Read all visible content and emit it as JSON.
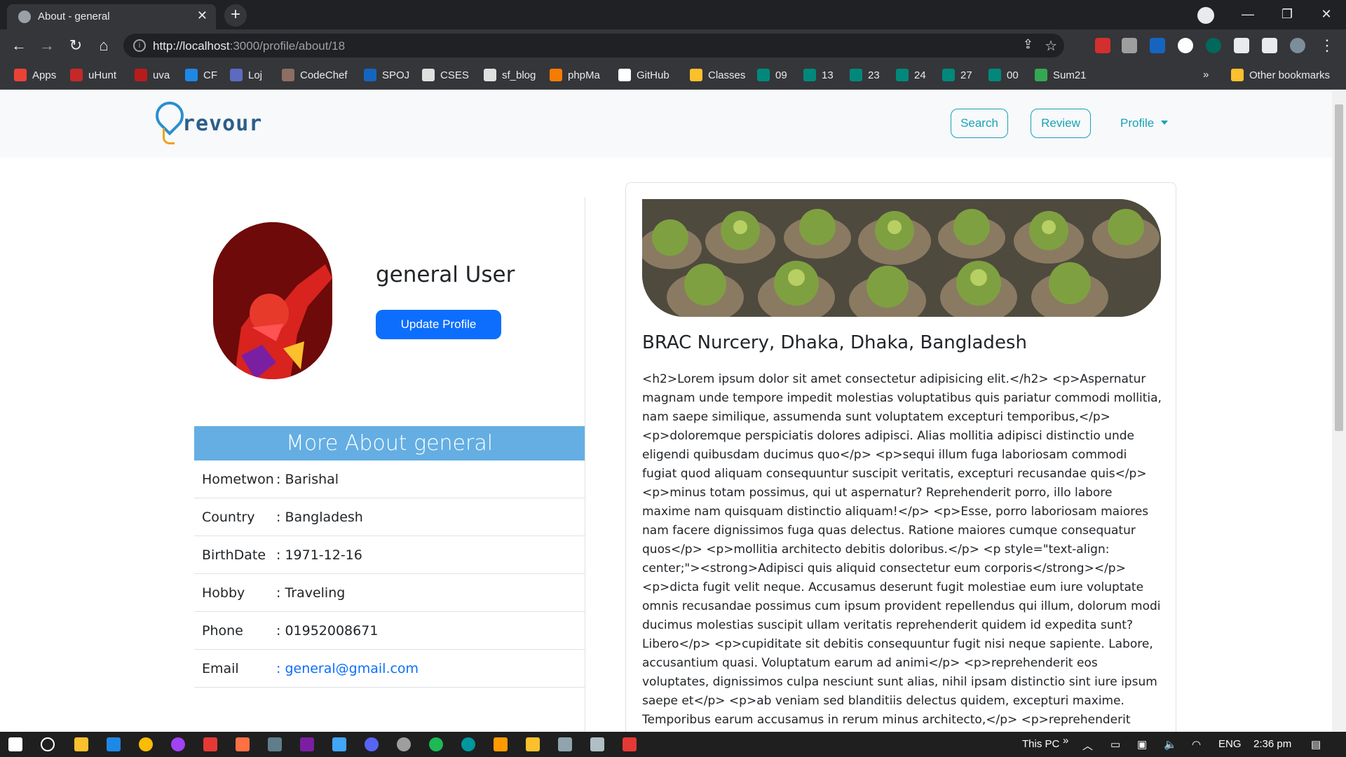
{
  "browser": {
    "tab_title": "About - general",
    "tab_close": "✕",
    "new_tab": "+",
    "url_host": "http://localhost",
    "url_path": ":3000/profile/about/18",
    "window_controls": [
      "—",
      "❐",
      "✕"
    ]
  },
  "bookmarks": [
    {
      "label": "Apps",
      "color": "#ea4335"
    },
    {
      "label": "uHunt",
      "color": "#c62828"
    },
    {
      "label": "uva",
      "color": "#b71c1c"
    },
    {
      "label": "CF",
      "color": "#1e88e5"
    },
    {
      "label": "Loj",
      "color": "#5c6bc0"
    },
    {
      "label": "CodeChef",
      "color": "#8d6e63"
    },
    {
      "label": "SPOJ",
      "color": "#1565c0"
    },
    {
      "label": "CSES",
      "color": "#e0e0e0"
    },
    {
      "label": "sf_blog",
      "color": "#e0e0e0"
    },
    {
      "label": "phpMa",
      "color": "#f57c00"
    },
    {
      "label": "GitHub",
      "color": "#ffffff"
    },
    {
      "label": "Classes",
      "color": "#fbc02d"
    },
    {
      "label": "09",
      "color": "#00897b"
    },
    {
      "label": "13",
      "color": "#00897b"
    },
    {
      "label": "23",
      "color": "#00897b"
    },
    {
      "label": "24",
      "color": "#00897b"
    },
    {
      "label": "27",
      "color": "#00897b"
    },
    {
      "label": "00",
      "color": "#00897b"
    },
    {
      "label": "Sum21",
      "color": "#34a853"
    }
  ],
  "bookmarks_overflow": "»",
  "other_bookmarks": "Other bookmarks",
  "site": {
    "logo_text": "revour",
    "nav_search": "Search",
    "nav_review": "Review",
    "nav_profile": "Profile"
  },
  "profile": {
    "name": "general User",
    "update_button": "Update Profile",
    "more_about_title": "More About general",
    "fields": [
      {
        "key": "Hometwon",
        "value": ": Barishal"
      },
      {
        "key": "Country",
        "value": ": Bangladesh"
      },
      {
        "key": "BirthDate",
        "value": ": 1971-12-16"
      },
      {
        "key": "Hobby",
        "value": ": Traveling"
      },
      {
        "key": "Phone",
        "value": ": 01952008671"
      },
      {
        "key": "Email",
        "value_prefix": ": ",
        "value": "general@gmail.com"
      }
    ]
  },
  "card": {
    "place": "BRAC Nurcery, Dhaka, Dhaka, Bangladesh",
    "description": "<h2>Lorem ipsum dolor sit amet consectetur adipisicing elit.</h2> <p>Aspernatur magnam unde tempore impedit molestias voluptatibus quis pariatur commodi mollitia, nam saepe similique, assumenda sunt voluptatem excepturi temporibus,</p> <p>doloremque perspiciatis dolores adipisci. Alias mollitia adipisci distinctio unde eligendi quibusdam ducimus quo</p> <p>sequi illum fuga laboriosam commodi fugiat quod aliquam consequuntur suscipit veritatis, excepturi recusandae quis</p> <p>minus totam possimus, qui ut aspernatur? Reprehenderit porro, illo labore maxime nam quisquam distinctio aliquam!</p> <p>Esse, porro laboriosam maiores nam facere dignissimos fuga quas delectus. Ratione maiores cumque consequatur quos</p> <p>mollitia architecto debitis doloribus.</p> <p style=\"text-align: center;\"><strong>Adipisci quis aliquid consectetur eum corporis</strong></p> <p>dicta fugit velit neque. Accusamus deserunt fugit molestiae eum iure voluptate omnis recusandae possimus cum ipsum provident repellendus qui illum, dolorum modi ducimus molestias suscipit ullam veritatis reprehenderit quidem id expedita sunt? Libero</p> <p>cupiditate sit debitis consequuntur fugit nisi neque sapiente. Labore, accusantium quasi. Voluptatum earum ad animi</p> <p>reprehenderit eos voluptates, dignissimos culpa nesciunt sunt alias, nihil ipsam distinctio sint iure ipsum saepe et</p> <p>ab veniam sed blanditiis delectus quidem, excepturi maxime. Temporibus earum accusamus in rerum minus architecto,</p> <p>reprehenderit voluptate distinctio maiores quas veritatis dolores ab vel. Debitis quas quasi consequatur sed</p> <p>perferendis?"
  },
  "taskbar": {
    "this_pc": "This PC",
    "chevron": "»",
    "language": "ENG",
    "time": "2:36 pm"
  }
}
